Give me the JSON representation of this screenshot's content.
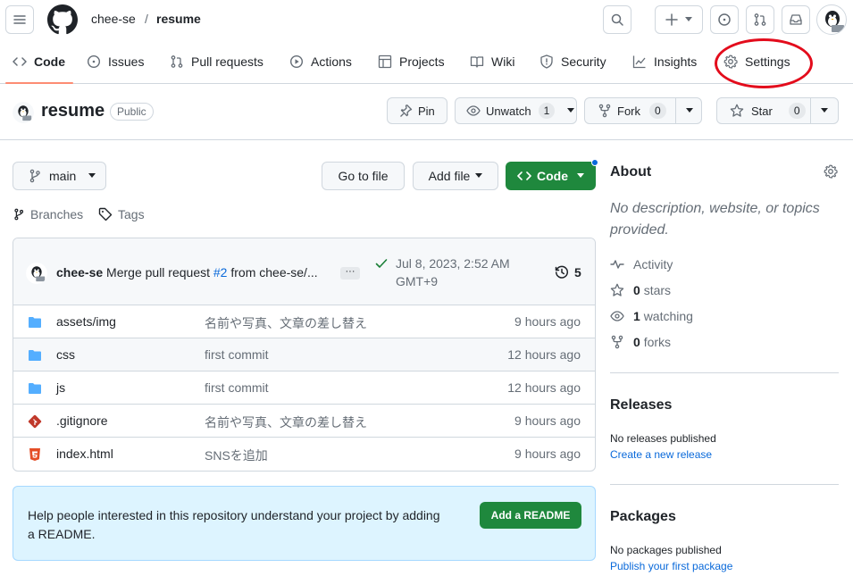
{
  "header": {
    "owner": "chee-se",
    "separator": "/",
    "repo": "resume"
  },
  "nav": {
    "items": [
      {
        "label": "Code",
        "icon": "code-icon"
      },
      {
        "label": "Issues",
        "icon": "issue-icon"
      },
      {
        "label": "Pull requests",
        "icon": "pull-request-icon"
      },
      {
        "label": "Actions",
        "icon": "play-icon"
      },
      {
        "label": "Projects",
        "icon": "table-icon"
      },
      {
        "label": "Wiki",
        "icon": "book-icon"
      },
      {
        "label": "Security",
        "icon": "shield-icon"
      },
      {
        "label": "Insights",
        "icon": "graph-icon"
      },
      {
        "label": "Settings",
        "icon": "gear-icon"
      }
    ],
    "active": "Code"
  },
  "repo": {
    "name": "resume",
    "visibility": "Public",
    "pin_label": "Pin",
    "unwatch_label": "Unwatch",
    "watch_count": "1",
    "fork_label": "Fork",
    "fork_count": "0",
    "star_label": "Star",
    "star_count": "0"
  },
  "toolbar": {
    "branch": "main",
    "go_to_file": "Go to file",
    "add_file": "Add file",
    "code": "Code",
    "branches": "Branches",
    "tags": "Tags"
  },
  "commit": {
    "author": "chee-se",
    "message_pre": "Merge pull request",
    "pr_link": "#2",
    "message_post": "from chee-se/...",
    "ellipsis": "···",
    "date_line1": "Jul 8, 2023, 2:52 AM",
    "date_line2": "GMT+9",
    "history_count": "5"
  },
  "files": [
    {
      "name": "assets/img",
      "message": "名前や写真、文章の差し替え",
      "time": "9 hours ago",
      "icon": "folder-icon"
    },
    {
      "name": "css",
      "message": "first commit",
      "time": "12 hours ago",
      "icon": "folder-icon"
    },
    {
      "name": "js",
      "message": "first commit",
      "time": "12 hours ago",
      "icon": "folder-icon"
    },
    {
      "name": ".gitignore",
      "message": "名前や写真、文章の差し替え",
      "time": "9 hours ago",
      "icon": "git-file-icon"
    },
    {
      "name": "index.html",
      "message": "SNSを追加",
      "time": "9 hours ago",
      "icon": "html-file-icon"
    }
  ],
  "readme": {
    "text": "Help people interested in this repository understand your project by adding a README.",
    "button": "Add a README"
  },
  "about": {
    "heading": "About",
    "description": "No description, website, or topics provided.",
    "activity": "Activity",
    "stars_count": "0",
    "stars_label": "stars",
    "watching_count": "1",
    "watching_label": "watching",
    "forks_count": "0",
    "forks_label": "forks"
  },
  "releases": {
    "heading": "Releases",
    "empty": "No releases published",
    "link": "Create a new release"
  },
  "packages": {
    "heading": "Packages",
    "empty": "No packages published",
    "link": "Publish your first package"
  },
  "colors": {
    "green": "#1f883d",
    "blue": "#0969da",
    "highlight_ellipse": "#e30c1c",
    "nav_underline": "#fd8c73"
  }
}
